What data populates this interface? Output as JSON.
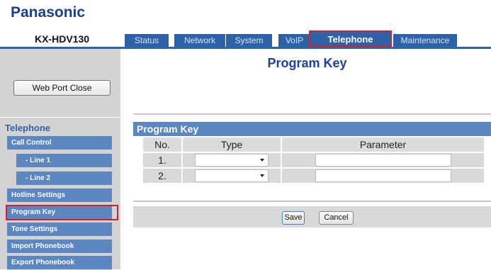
{
  "brand": "Panasonic",
  "model": "KX-HDV130",
  "tabs": [
    {
      "label": "Status"
    },
    {
      "label": "Network"
    },
    {
      "label": "System"
    },
    {
      "label": "VoIP"
    },
    {
      "label": "Telephone",
      "active": true
    },
    {
      "label": "Maintenance"
    }
  ],
  "sidebar": {
    "web_port_close_label": "Web Port Close",
    "section_title": "Telephone",
    "items": [
      {
        "label": "Call Control"
      },
      {
        "label": "- Line 1"
      },
      {
        "label": "- Line 2"
      },
      {
        "label": "Hotline Settings"
      },
      {
        "label": "Program Key",
        "selected": true
      },
      {
        "label": "Tone Settings"
      },
      {
        "label": "Import Phonebook"
      },
      {
        "label": "Export Phonebook"
      }
    ]
  },
  "main": {
    "page_title": "Program Key",
    "section_header": "Program Key",
    "table": {
      "headers": [
        "No.",
        "Type",
        "Parameter"
      ],
      "rows": [
        {
          "no": "1.",
          "type": "",
          "parameter": ""
        },
        {
          "no": "2.",
          "type": "",
          "parameter": ""
        }
      ]
    },
    "save_label": "Save",
    "cancel_label": "Cancel"
  },
  "colors": {
    "accent": "#2e62a6",
    "menu_bg": "#5b86c2",
    "highlight": "#d8202a",
    "title": "#1e3f9a"
  }
}
